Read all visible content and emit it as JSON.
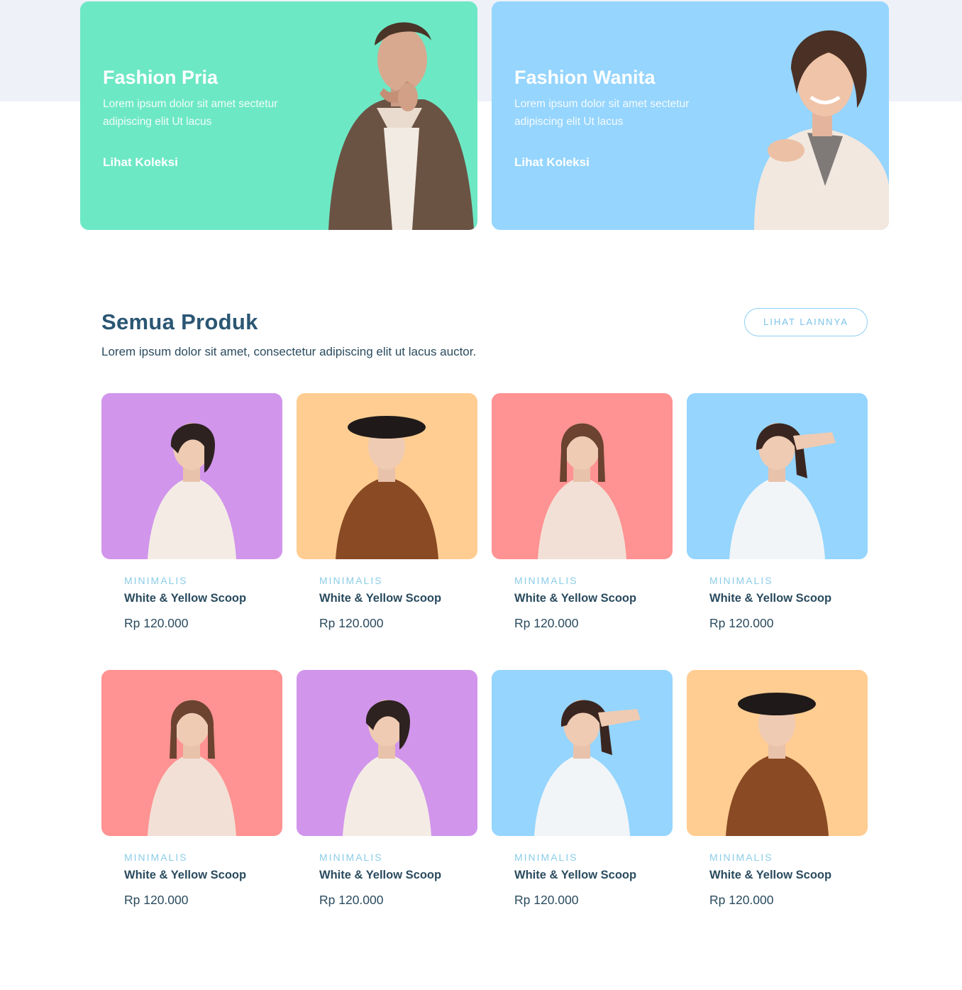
{
  "colors": {
    "page_band": "#eef2f8",
    "men_card": "#6de8c4",
    "women_card": "#95d5fe",
    "purple": "#d195ec",
    "orange": "#ffcd92",
    "red": "#ff9292",
    "blue": "#95d5fe",
    "accent": "#8ed0f2"
  },
  "promos": [
    {
      "title": "Fashion Pria",
      "description": "Lorem ipsum dolor sit amet sectetur adipiscing elit Ut lacus",
      "link": "Lihat Koleksi"
    },
    {
      "title": "Fashion Wanita",
      "description": "Lorem ipsum dolor sit amet sectetur adipiscing elit Ut lacus",
      "link": "Lihat Koleksi"
    }
  ],
  "section": {
    "title": "Semua Produk",
    "subtitle": "Lorem ipsum dolor sit amet, consectetur adipiscing elit ut lacus auctor.",
    "more_button": "LIHAT LAINNYA"
  },
  "products": [
    {
      "category": "MINIMALIS",
      "name": "White & Yellow Scoop",
      "price": "Rp 120.000",
      "bg": "purple"
    },
    {
      "category": "MINIMALIS",
      "name": "White & Yellow Scoop",
      "price": "Rp 120.000",
      "bg": "orange"
    },
    {
      "category": "MINIMALIS",
      "name": "White & Yellow Scoop",
      "price": "Rp 120.000",
      "bg": "red"
    },
    {
      "category": "MINIMALIS",
      "name": "White & Yellow Scoop",
      "price": "Rp 120.000",
      "bg": "blue"
    },
    {
      "category": "MINIMALIS",
      "name": "White & Yellow Scoop",
      "price": "Rp 120.000",
      "bg": "red"
    },
    {
      "category": "MINIMALIS",
      "name": "White & Yellow Scoop",
      "price": "Rp 120.000",
      "bg": "purple"
    },
    {
      "category": "MINIMALIS",
      "name": "White & Yellow Scoop",
      "price": "Rp 120.000",
      "bg": "blue"
    },
    {
      "category": "MINIMALIS",
      "name": "White & Yellow Scoop",
      "price": "Rp 120.000",
      "bg": "orange"
    }
  ]
}
